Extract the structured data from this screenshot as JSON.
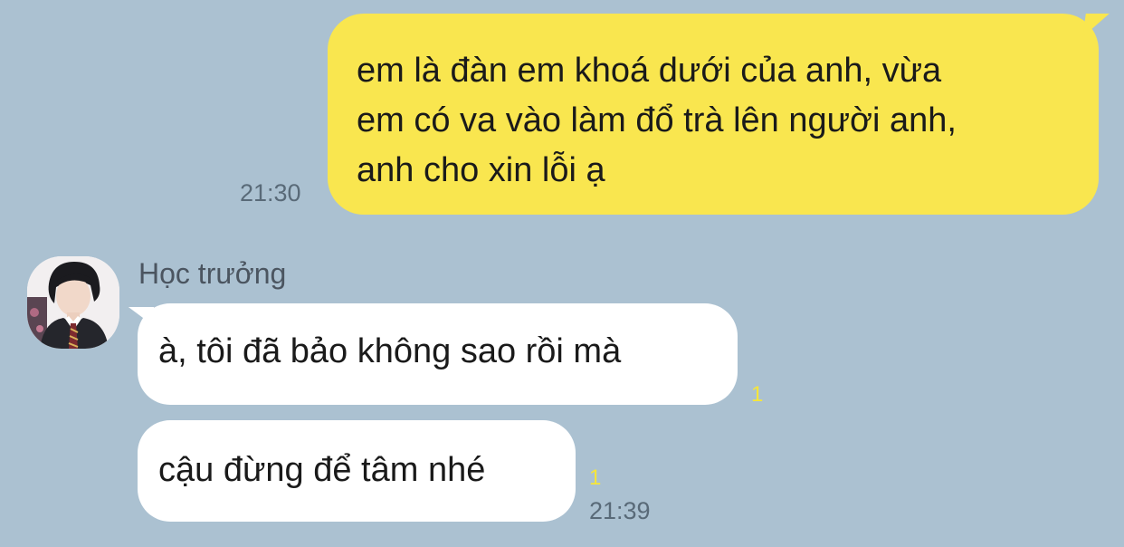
{
  "outgoing": {
    "lines": [
      "em là đàn em khoá dưới của anh, vừa",
      "em có va vào làm đổ trà lên người anh,",
      "anh cho xin lỗi ạ"
    ],
    "time": "21:30",
    "bubble_color": "#f9e64f"
  },
  "incoming": {
    "sender_name": "Học trưởng",
    "avatar_icon": "profile-photo",
    "messages": [
      {
        "text": "à, tôi đã bảo không sao rồi mà",
        "unread": "1"
      },
      {
        "text": "cậu đừng để tâm nhé",
        "unread": "1"
      }
    ],
    "time": "21:39"
  },
  "colors": {
    "background": "#abc1d1",
    "unread_count": "#f6e63a"
  }
}
